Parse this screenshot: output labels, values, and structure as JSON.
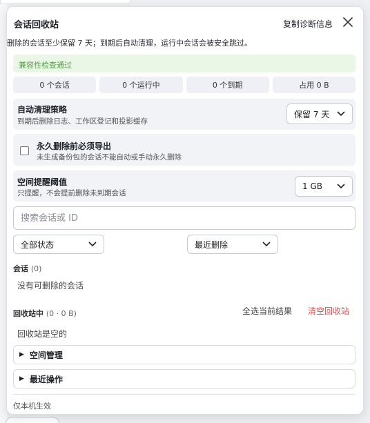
{
  "panel": {
    "title": "会话回收站",
    "copy_diag_label": "复制诊断信息",
    "description": "删除的会话至少保留 7 天；到期后自动清理，运行中会话会被安全跳过。"
  },
  "status": {
    "text": "兼容性检查通过"
  },
  "stats": [
    "0 个会话",
    "0 个运行中",
    "0 个到期",
    "占用 0 B"
  ],
  "auto_clean": {
    "title": "自动清理策略",
    "subtitle": "到期后删除日志、工作区登记和投影缓存",
    "selected": "保留 7 天"
  },
  "export_required": {
    "title": "永久删除前必须导出",
    "subtitle": "未生成备份包的会话不能自动或手动永久删除",
    "checked": false
  },
  "space_threshold": {
    "title": "空间提醒阈值",
    "subtitle": "只提醒，不会提前删除未到期会话",
    "selected": "1 GB"
  },
  "search": {
    "placeholder": "搜索会话或 ID"
  },
  "filters": {
    "status_selected": "全部状态",
    "sort_selected": "最近删除"
  },
  "sessions": {
    "title": "会话",
    "count": "(0)",
    "empty": "没有可删除的会话"
  },
  "recycle": {
    "title": "回收站中",
    "count": "(0 · 0 B)",
    "select_all": "全选当前结果",
    "empty_bin": "清空回收站",
    "empty": "回收站是空的"
  },
  "sections": {
    "space_mgmt": "空间管理",
    "recent_ops": "最近操作"
  },
  "footer": {
    "text": "仅本机生效"
  },
  "colors": {
    "danger": "#d9534f",
    "success_bg": "#eaf6e6",
    "success_text": "#5a9a4a"
  }
}
